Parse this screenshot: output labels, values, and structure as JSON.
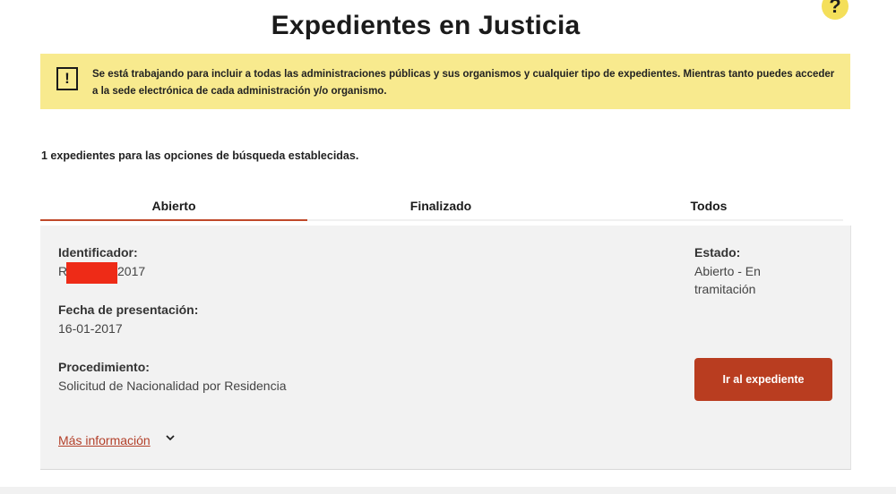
{
  "header": {
    "title": "Expedientes en Justicia",
    "help_label": "?"
  },
  "notice": {
    "icon": "!",
    "icon_name": "warning-icon",
    "text": "Se está trabajando para incluir a todas las administraciones públicas y sus organismos y cualquier tipo de expedientes. Mientras tanto puedes acceder a la sede electrónica de cada administración y/o organismo."
  },
  "results": {
    "count_text": "1 expedientes para las opciones de búsqueda establecidas."
  },
  "tabs": [
    {
      "label": "Abierto",
      "active": true
    },
    {
      "label": "Finalizado",
      "active": false
    },
    {
      "label": "Todos",
      "active": false
    }
  ],
  "expediente": {
    "identifier_label": "Identificador:",
    "identifier_prefix": "R",
    "identifier_suffix": "2017",
    "date_label": "Fecha de presentación:",
    "date_value": "16-01-2017",
    "procedure_label": "Procedimiento:",
    "procedure_value": "Solicitud de Nacionalidad por Residencia",
    "status_label": "Estado:",
    "status_value": "Abierto - En tramitación",
    "action_button": "Ir al expediente",
    "more_info": "Más información"
  },
  "colors": {
    "accent": "#b93d20",
    "notice_bg": "#f8ea8e",
    "help_bg": "#f4df5a",
    "redaction": "#ee2b17",
    "card_bg": "#f2f2f2"
  }
}
